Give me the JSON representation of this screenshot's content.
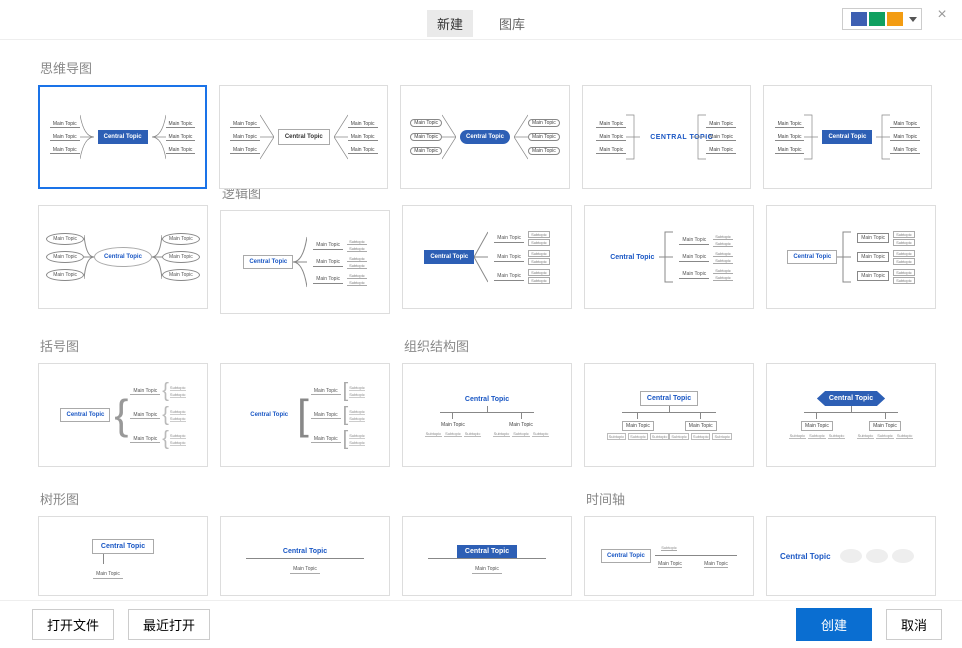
{
  "header": {
    "tab_new": "新建",
    "tab_library": "图库"
  },
  "sections": {
    "mindmap": "思维导图",
    "logic": "逻辑图",
    "bracket": "括号图",
    "org": "组织结构图",
    "tree": "树形图",
    "timeline": "时间轴"
  },
  "labels": {
    "central_topic": "Central Topic",
    "central_topic_upper": "CENTRAL TOPIC",
    "main_topic": "Main Topic",
    "subtopic": "Subtopic"
  },
  "footer": {
    "open_file": "打开文件",
    "recent_open": "最近打开",
    "create": "创建",
    "cancel": "取消"
  },
  "colors": {
    "swatch1": "#3d5fb2",
    "swatch2": "#10a060",
    "swatch3": "#f39c12"
  }
}
